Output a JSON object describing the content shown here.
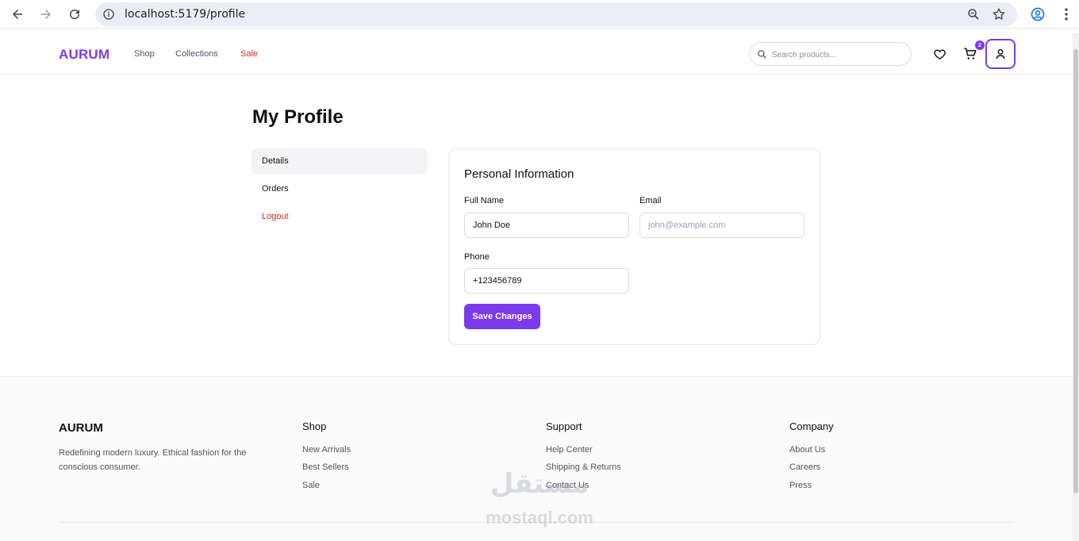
{
  "browser": {
    "url": "localhost:5179/profile",
    "icons": [
      "back-arrow-icon",
      "forward-arrow-icon",
      "reload-icon",
      "site-info-icon",
      "zoom-icon",
      "bookmark-star-icon",
      "account-icon",
      "kebab-menu-icon"
    ]
  },
  "header": {
    "logo": "AURUM",
    "nav": {
      "shop": "Shop",
      "collections": "Collections",
      "sale": "Sale"
    },
    "search_placeholder": "Search products...",
    "cart_count": "2",
    "accent": "#7c3aed",
    "sale_color": "#dc2626"
  },
  "profile": {
    "title": "My Profile",
    "menu": {
      "details": "Details",
      "orders": "Orders",
      "logout": "Logout"
    },
    "card": {
      "title": "Personal Information",
      "full_name_label": "Full Name",
      "full_name_value": "John Doe",
      "email_label": "Email",
      "email_placeholder": "john@example.com",
      "phone_label": "Phone",
      "phone_value": "+123456789",
      "save_label": "Save Changes"
    }
  },
  "footer": {
    "logo": "AURUM",
    "description": "Redefining modern luxury. Ethical fashion for the conscious consumer.",
    "shop": {
      "title": "Shop",
      "links": [
        "New Arrivals",
        "Best Sellers",
        "Sale"
      ]
    },
    "support": {
      "title": "Support",
      "links": [
        "Help Center",
        "Shipping & Returns",
        "Contact Us"
      ]
    },
    "company": {
      "title": "Company",
      "links": [
        "About Us",
        "Careers",
        "Press"
      ]
    }
  },
  "watermark": {
    "arabic": "مستقل",
    "latin": "mostaql.com"
  }
}
